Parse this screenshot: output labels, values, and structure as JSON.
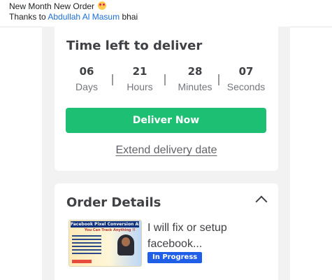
{
  "post": {
    "line1": "New Month New Order",
    "line2_prefix": "Thanks to",
    "mention": "Abdullah Al Masum",
    "line2_suffix": "bhai"
  },
  "delivery": {
    "title": "Time left to deliver",
    "countdown": [
      {
        "value": "06",
        "label": "Days"
      },
      {
        "value": "21",
        "label": "Hours"
      },
      {
        "value": "28",
        "label": "Minutes"
      },
      {
        "value": "07",
        "label": "Seconds"
      }
    ],
    "deliver_button": "Deliver Now",
    "extend_link": "Extend delivery date"
  },
  "order": {
    "title": "Order Details",
    "gig_title": "I will fix or setup facebook...",
    "status": "In Progress",
    "thumbnail": {
      "title": "Facebook Pixel Conversion API",
      "subtitle": "You Can Track Anything !!"
    }
  },
  "colors": {
    "accent_green": "#1dbf73",
    "status_blue": "#1f5ee6",
    "mention_blue": "#1d6fd8"
  }
}
